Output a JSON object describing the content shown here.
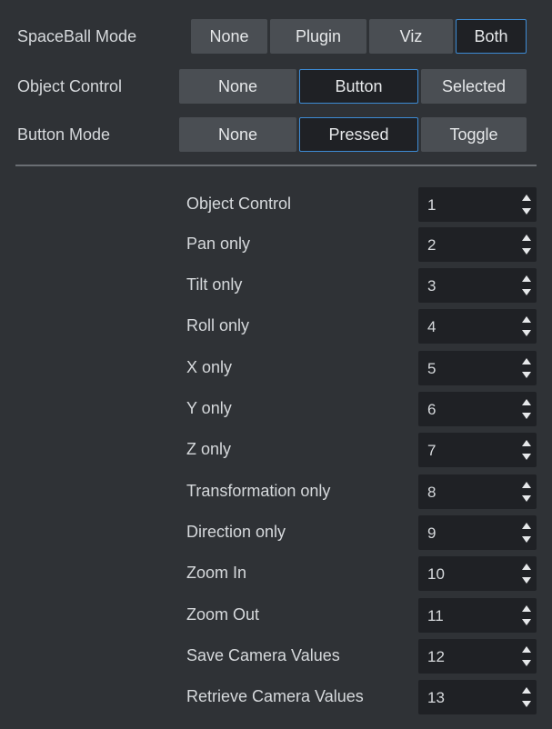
{
  "modes": {
    "spaceball": {
      "label": "SpaceBall Mode",
      "options": [
        "None",
        "Plugin",
        "Viz",
        "Both"
      ],
      "selected": "Both"
    },
    "object_control": {
      "label": "Object Control",
      "options": [
        "None",
        "Button",
        "Selected"
      ],
      "selected": "Button"
    },
    "button_mode": {
      "label": "Button Mode",
      "options": [
        "None",
        "Pressed",
        "Toggle"
      ],
      "selected": "Pressed"
    }
  },
  "mappings": [
    {
      "label": "Object Control",
      "value": "1"
    },
    {
      "label": "Pan only",
      "value": "2"
    },
    {
      "label": "Tilt only",
      "value": "3"
    },
    {
      "label": "Roll only",
      "value": "4"
    },
    {
      "label": "X only",
      "value": "5"
    },
    {
      "label": "Y only",
      "value": "6"
    },
    {
      "label": "Z only",
      "value": "7"
    },
    {
      "label": "Transformation only",
      "value": "8"
    },
    {
      "label": "Direction only",
      "value": "9"
    },
    {
      "label": "Zoom In",
      "value": "10"
    },
    {
      "label": "Zoom Out",
      "value": "11"
    },
    {
      "label": "Save Camera Values",
      "value": "12"
    },
    {
      "label": "Retrieve Camera Values",
      "value": "13"
    }
  ],
  "icons": {
    "spinner": "spinner-arrows-icon"
  },
  "colors": {
    "background": "#2f3236",
    "button": "#4a4e53",
    "selected_button": "#1f2125",
    "selected_border": "#3d8bd4",
    "text": "#d6d9dc"
  }
}
